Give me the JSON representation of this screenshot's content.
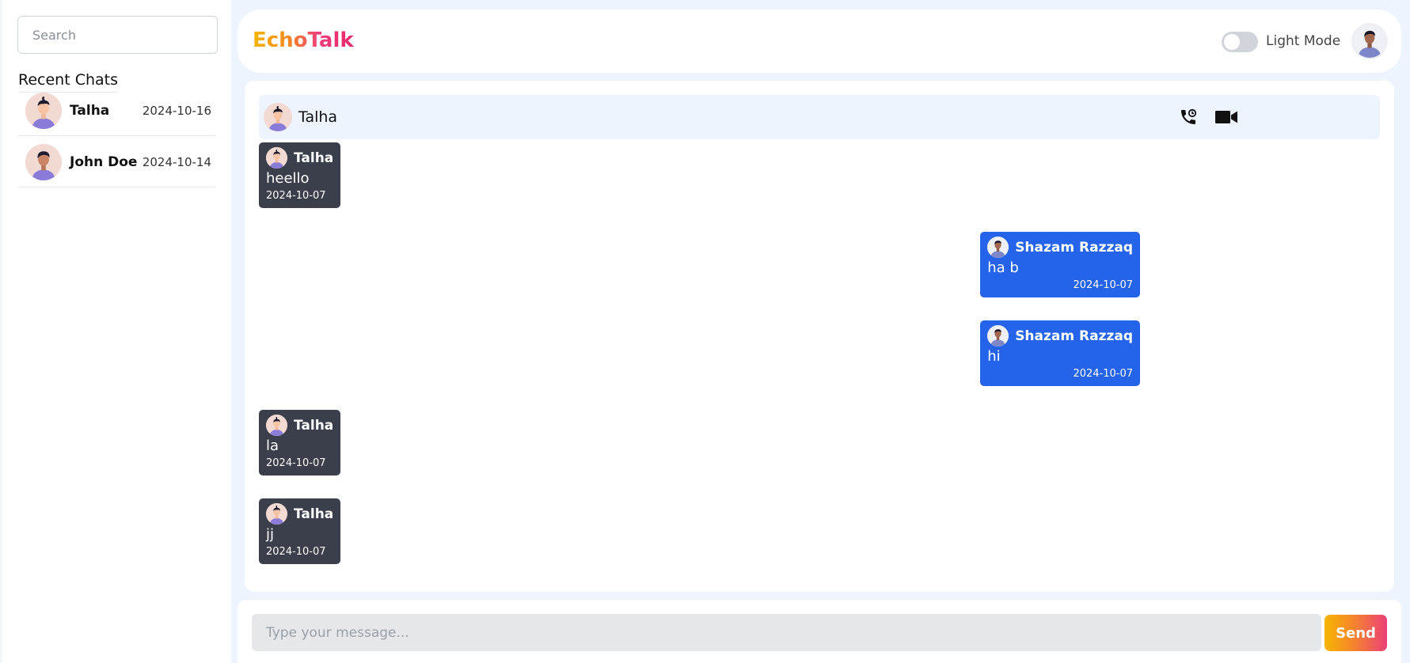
{
  "sidebar": {
    "search_placeholder": "Search",
    "recent_title": "Recent Chats",
    "chats": [
      {
        "name": "Talha",
        "date": "2024-10-16"
      },
      {
        "name": "John Doe",
        "date": "2024-10-14"
      }
    ]
  },
  "header": {
    "app_name": "EchoTalk",
    "mode_label": "Light Mode",
    "toggle_on": false
  },
  "chat": {
    "contact_name": "Talha",
    "icons": [
      "phone-call-icon",
      "video-camera-icon"
    ],
    "messages": [
      {
        "sender": "Talha",
        "text": "heello",
        "date": "2024-10-07",
        "direction": "incoming"
      },
      {
        "sender": "Shazam Razzaq",
        "text": "ha b",
        "date": "2024-10-07",
        "direction": "outgoing"
      },
      {
        "sender": "Shazam Razzaq",
        "text": "hi",
        "date": "2024-10-07",
        "direction": "outgoing"
      },
      {
        "sender": "Talha",
        "text": "la",
        "date": "2024-10-07",
        "direction": "incoming"
      },
      {
        "sender": "Talha",
        "text": "jj",
        "date": "2024-10-07",
        "direction": "incoming"
      }
    ]
  },
  "composer": {
    "placeholder": "Type your message...",
    "send_label": "Send"
  },
  "colors": {
    "incoming_bubble": "#3a3f4b",
    "outgoing_bubble": "#2563eb",
    "page_background": "#eef4fd",
    "brand_gradient_start": "#f7b500",
    "brand_gradient_end": "#e8276b"
  }
}
